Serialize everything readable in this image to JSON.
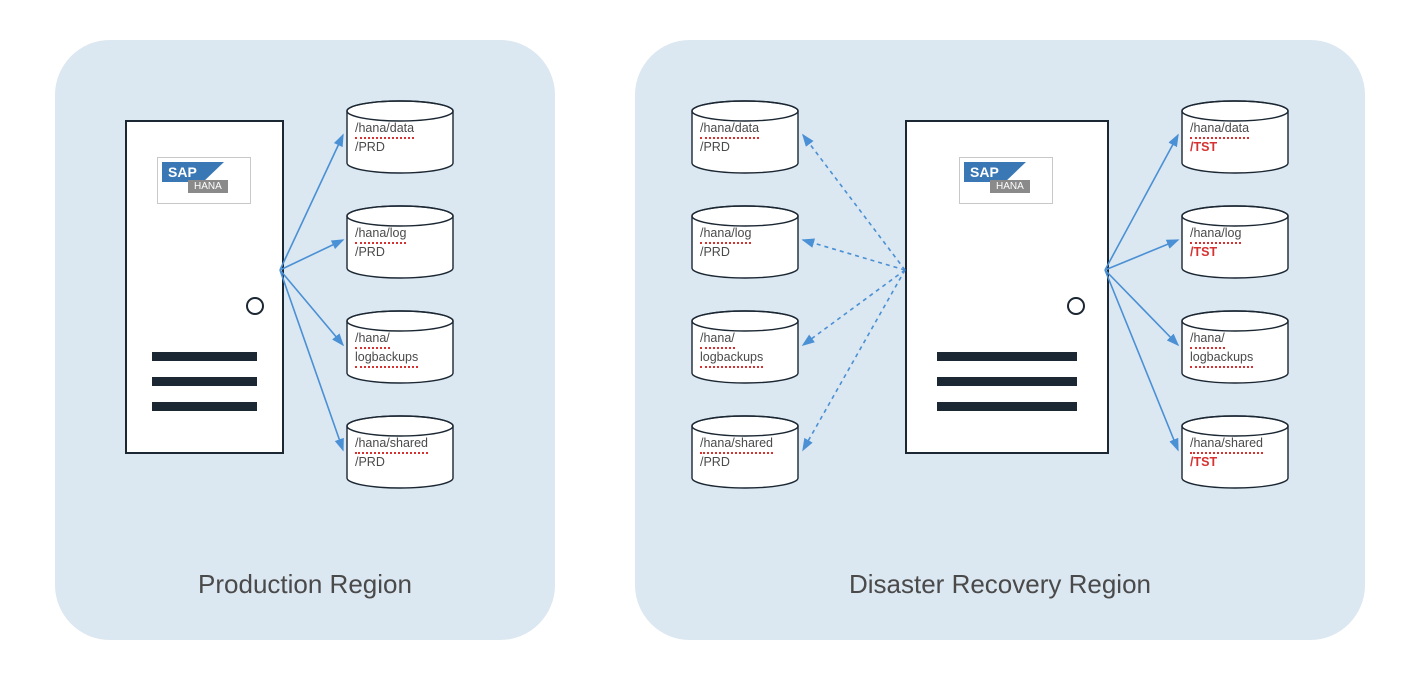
{
  "prod": {
    "title": "Production Region",
    "cyl": {
      "data": {
        "l1": "/hana/data",
        "l2": "/PRD"
      },
      "log": {
        "l1": "/hana/log",
        "l2": "/PRD"
      },
      "bkups": {
        "l1": "/hana/",
        "l2": "logbackups"
      },
      "shared": {
        "l1": "/hana/shared",
        "l2": "/PRD"
      }
    }
  },
  "dr": {
    "title": "Disaster Recovery Region",
    "left_cyl": {
      "data": {
        "l1": "/hana/data",
        "l2": "/PRD"
      },
      "log": {
        "l1": "/hana/log",
        "l2": "/PRD"
      },
      "bkups": {
        "l1": "/hana/",
        "l2": "logbackups"
      },
      "shared": {
        "l1": "/hana/shared",
        "l2": "/PRD"
      }
    },
    "right_cyl": {
      "data": {
        "l1": "/hana/data",
        "l2": "/TST"
      },
      "log": {
        "l1": "/hana/log",
        "l2": "/TST"
      },
      "bkups": {
        "l1": "/hana/",
        "l2": "logbackups"
      },
      "shared": {
        "l1": "/hana/shared",
        "l2": "/TST"
      }
    }
  },
  "sap_label": "SAP",
  "hana_label": "HANA",
  "colors": {
    "region_bg": "#dbe7f1",
    "stroke": "#4a90d4",
    "ink": "#1b2733",
    "emph": "#d63232"
  }
}
